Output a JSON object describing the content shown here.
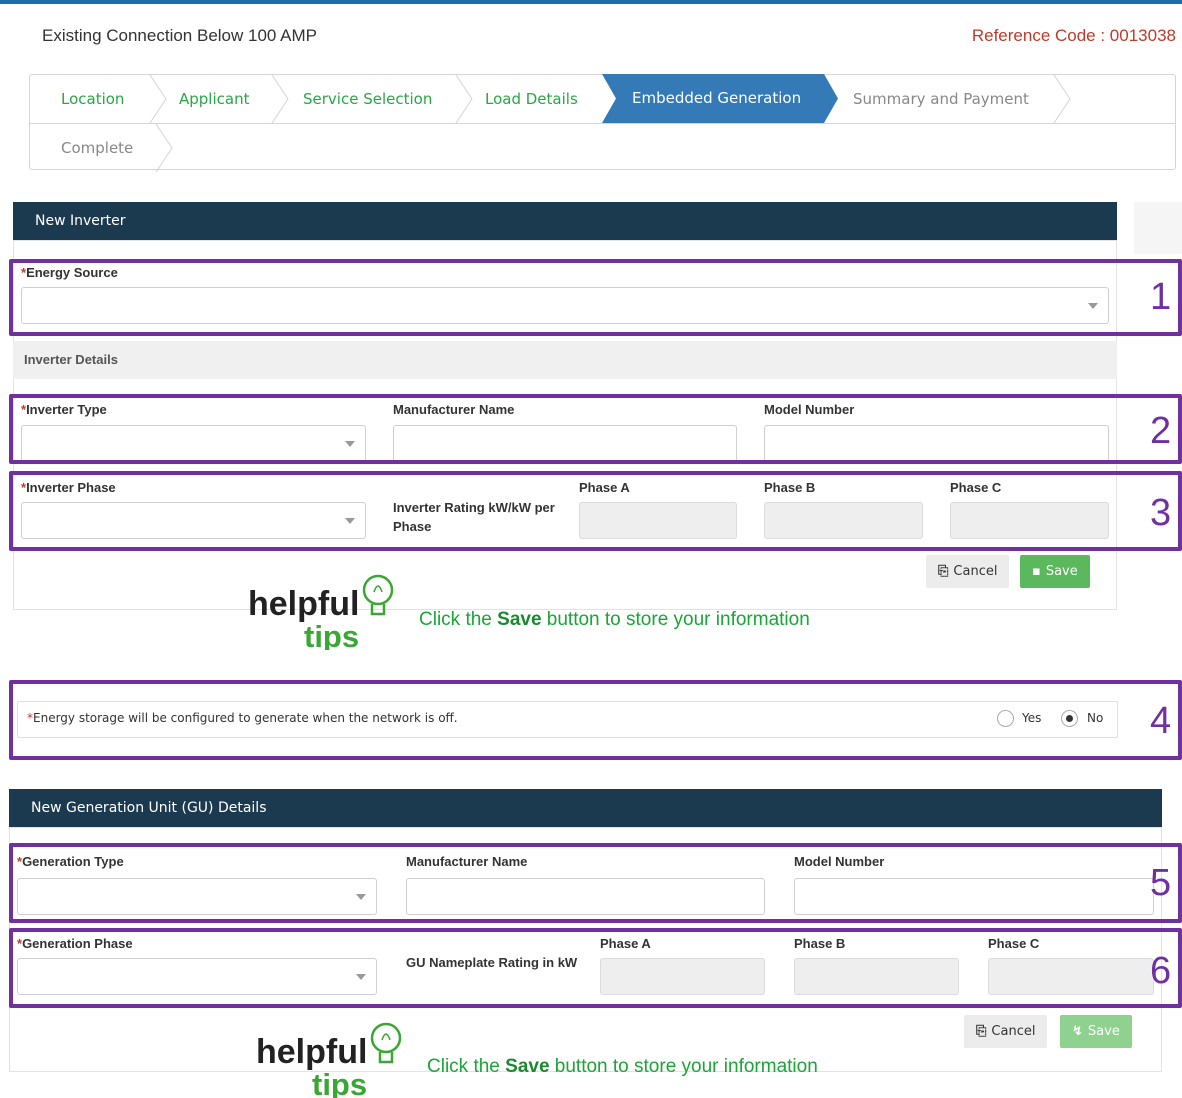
{
  "header": {
    "title": "Existing Connection Below 100 AMP",
    "reference_code": "Reference Code : 0013038"
  },
  "wizard": {
    "steps": [
      {
        "label": "Location",
        "state": "completed"
      },
      {
        "label": "Applicant",
        "state": "completed"
      },
      {
        "label": "Service Selection",
        "state": "completed"
      },
      {
        "label": "Load Details",
        "state": "completed"
      },
      {
        "label": "Embedded Generation",
        "state": "active"
      },
      {
        "label": "Summary and Payment",
        "state": "pending"
      },
      {
        "label": "Complete",
        "state": "pending"
      }
    ]
  },
  "inverter": {
    "panel_title": "New Inverter",
    "energy_source_label": "Energy Source",
    "energy_source_value": "",
    "details_heading": "Inverter Details",
    "inverter_type_label": "Inverter Type",
    "manufacturer_label": "Manufacturer Name",
    "model_label": "Model Number",
    "phase_label": "Inverter Phase",
    "rating_label": "Inverter Rating kW/kW per Phase",
    "phase_a_label": "Phase A",
    "phase_b_label": "Phase B",
    "phase_c_label": "Phase C",
    "cancel_label": "Cancel",
    "save_label": "Save"
  },
  "tips": {
    "logo_word1": "helpful",
    "logo_word2": "tips",
    "text_before": "Click the ",
    "text_bold": "Save",
    "text_after": " button to store your information"
  },
  "storage": {
    "question": "Energy storage will be configured to generate when the network is off.",
    "yes_label": "Yes",
    "no_label": "No",
    "selected": "No"
  },
  "generation": {
    "panel_title": "New Generation Unit (GU) Details",
    "type_label": "Generation Type",
    "manufacturer_label": "Manufacturer Name",
    "model_label": "Model Number",
    "phase_label": "Generation Phase",
    "rating_label": "GU Nameplate Rating in kW",
    "phase_a_label": "Phase A",
    "phase_b_label": "Phase B",
    "phase_c_label": "Phase C",
    "cancel_label": "Cancel",
    "save_label": "Save"
  },
  "annotations": [
    "1",
    "2",
    "3",
    "4",
    "5",
    "6"
  ],
  "colors": {
    "accent": "#337ab7",
    "completed_step": "#28a745",
    "panel_header": "#1b3a4f",
    "annotation": "#7030a0",
    "required": "#c0392b",
    "save_button": "#5cb85c"
  }
}
